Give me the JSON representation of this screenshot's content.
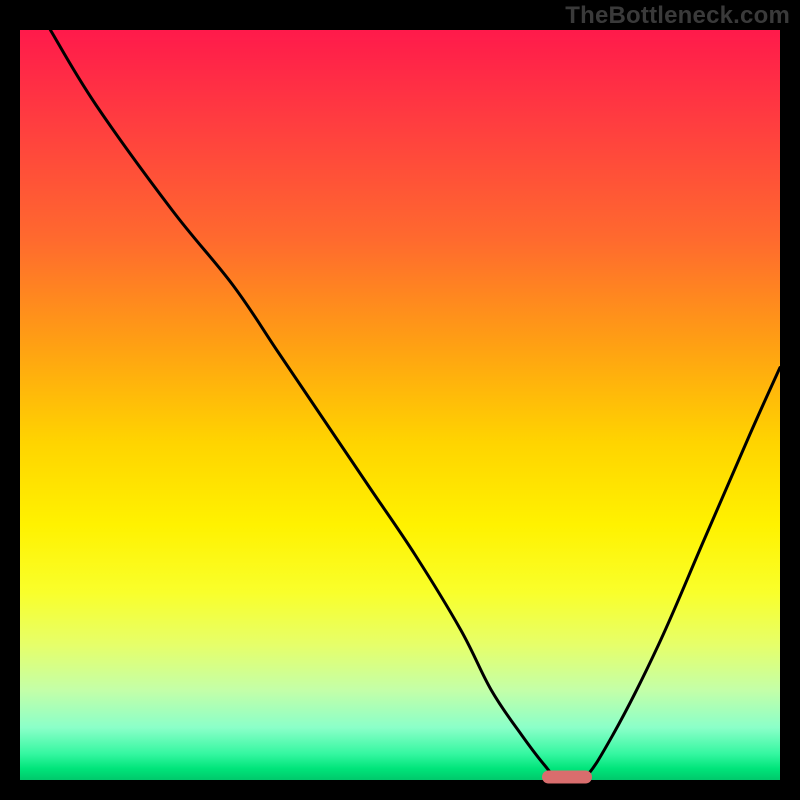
{
  "watermark": "TheBottleneck.com",
  "chart_data": {
    "type": "line",
    "title": "",
    "xlabel": "",
    "ylabel": "",
    "xlim": [
      0,
      100
    ],
    "ylim": [
      0,
      100
    ],
    "grid": false,
    "legend": false,
    "background_gradient": {
      "top_color": "#ff1a4b",
      "bottom_color": "#00c86b",
      "stops": [
        {
          "pos": 0.0,
          "color": "#ff1a4b"
        },
        {
          "pos": 0.55,
          "color": "#ffd400"
        },
        {
          "pos": 0.98,
          "color": "#00e47a"
        }
      ]
    },
    "series": [
      {
        "name": "bottleneck-curve",
        "x": [
          4,
          10,
          20,
          28,
          34,
          40,
          46,
          52,
          58,
          62,
          66,
          69,
          71,
          74,
          78,
          84,
          90,
          96,
          100
        ],
        "y": [
          100,
          90,
          76,
          66,
          57,
          48,
          39,
          30,
          20,
          12,
          6,
          2,
          0,
          0,
          6,
          18,
          32,
          46,
          55
        ]
      }
    ],
    "marker": {
      "x": 72,
      "y": 0,
      "color": "#d96d6d"
    }
  }
}
